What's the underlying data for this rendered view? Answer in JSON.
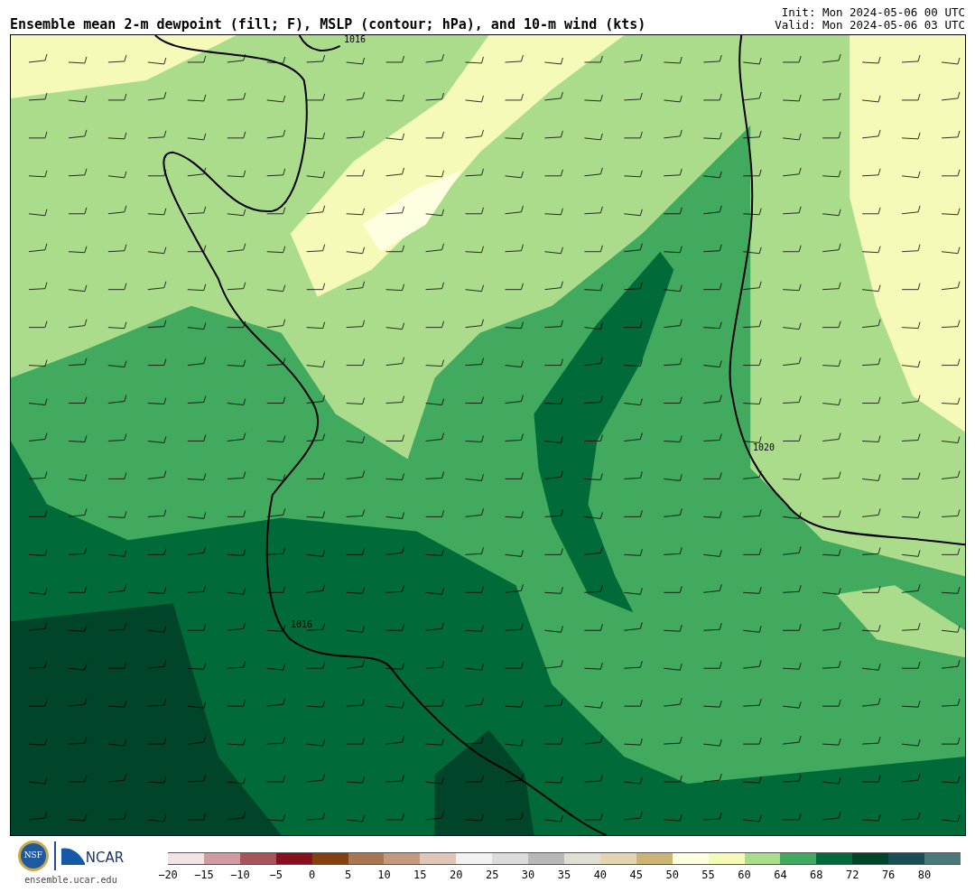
{
  "title": "Ensemble mean 2-m dewpoint (fill; F), MSLP (contour; hPa), and 10-m wind (kts)",
  "times": [
    "Init: Mon 2024-05-06 00 UTC",
    "Valid: Mon 2024-05-06 03 UTC"
  ],
  "map": {
    "contour_labels": [
      "1016",
      "1020",
      "1016"
    ]
  },
  "logos": {
    "nsf": "NSF",
    "ncar": "NCAR",
    "site": "ensemble.ucar.edu"
  },
  "colorbar": {
    "swatches": [
      {
        "label": "−20",
        "color": "#f2e4e4"
      },
      {
        "label": "−15",
        "color": "#d09ca0"
      },
      {
        "label": "−10",
        "color": "#a8545a"
      },
      {
        "label": "−5",
        "color": "#88101e"
      },
      {
        "label": "0",
        "color": "#85400f"
      },
      {
        "label": "5",
        "color": "#a97552"
      },
      {
        "label": "10",
        "color": "#c49a7e"
      },
      {
        "label": "15",
        "color": "#e0c6b6"
      },
      {
        "label": "20",
        "color": "#f2f2f2"
      },
      {
        "label": "25",
        "color": "#dcdcdc"
      },
      {
        "label": "30",
        "color": "#b8b8b8"
      },
      {
        "label": "35",
        "color": "#e0e0d2"
      },
      {
        "label": "40",
        "color": "#e4d4b0"
      },
      {
        "label": "45",
        "color": "#cdb476"
      },
      {
        "label": "50",
        "color": "#fefee0"
      },
      {
        "label": "55",
        "color": "#f6fab8"
      },
      {
        "label": "60",
        "color": "#abdc8c"
      },
      {
        "label": "64",
        "color": "#41aa5e"
      },
      {
        "label": "68",
        "color": "#006a38"
      },
      {
        "label": "72",
        "color": "#00452a"
      },
      {
        "label": "76",
        "color": "#1a4e56"
      },
      {
        "label": "80",
        "color": "#4a7878"
      }
    ]
  }
}
